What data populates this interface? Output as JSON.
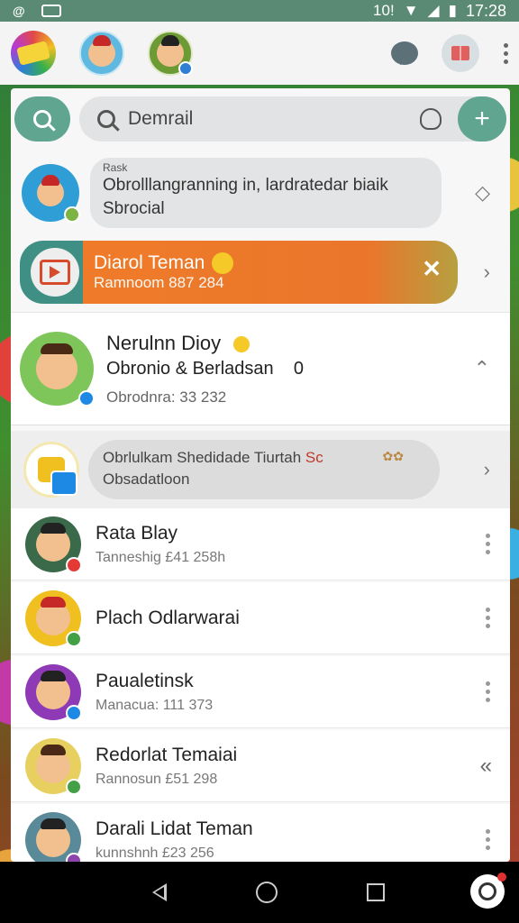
{
  "status_bar": {
    "left_icon_text": "@",
    "signal": "10!",
    "time": "17:28"
  },
  "search": {
    "value": "Demrail"
  },
  "chats": {
    "pinned_request": {
      "tag": "Rask",
      "message": "Obrolllangranning in, lardratedar biaik Sbrocial"
    },
    "highlight": {
      "title": "Diarol Teman",
      "subtitle": "Ramnoom 887 284"
    },
    "featured": {
      "name": "Nerulnn Dioy",
      "subtitle": "Obronio & Berladsan",
      "count": "0",
      "meta": "Obrodnra: 33 232"
    },
    "group_bubble": {
      "line1": "Obrlulkam Shedidade Tiurtah",
      "line1_accent": "Sc",
      "line2": "Obsadatloon"
    }
  },
  "friends": [
    {
      "name": "Rata Blay",
      "sub": "Tanneshig £41 258h",
      "badge_color": "#e53935",
      "action": "more"
    },
    {
      "name": "Plach Odlarwarai",
      "sub": "",
      "badge_color": "#43a047",
      "action": "more"
    },
    {
      "name": "Paualetinsk",
      "sub": "Manacua: 111 373",
      "badge_color": "#1e88e5",
      "action": "more"
    },
    {
      "name": "Redorlat Temaiai",
      "sub": "Rannosun £51 298",
      "badge_color": "#43a047",
      "action": "collapse"
    },
    {
      "name": "Darali Lidat Teman",
      "sub": "kunnshnh £23 256",
      "badge_color": "#8e44ad",
      "action": "more"
    }
  ],
  "colors": {
    "accent": "#5fa58f",
    "orange": "#ef7b2a",
    "status_bar": "#5a8a73"
  }
}
